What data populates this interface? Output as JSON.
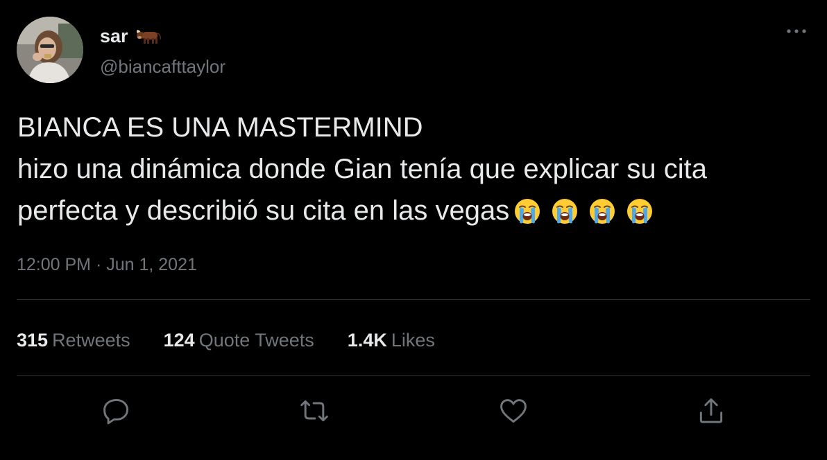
{
  "author": {
    "display_name": "sar",
    "name_emoji": "ox-emoji",
    "handle": "@biancafttaylor"
  },
  "tweet": {
    "lines": [
      "BIANCA ES UNA MASTERMIND",
      "hizo una dinámica donde Gian tenía que explicar su cita",
      "perfecta y describió su cita en las vegas"
    ],
    "trailing_emojis": [
      "loudly-crying-face",
      "loudly-crying-face",
      "loudly-crying-face",
      "loudly-crying-face"
    ],
    "timestamp": "12:00 PM · Jun 1, 2021"
  },
  "stats": {
    "retweets_count": "315",
    "retweets_label": "Retweets",
    "quotes_count": "124",
    "quotes_label": "Quote Tweets",
    "likes_count": "1.4K",
    "likes_label": "Likes"
  },
  "icons": {
    "more": "more-horizontal-icon",
    "reply": "reply-icon",
    "retweet": "retweet-icon",
    "like": "heart-icon",
    "share": "share-icon"
  },
  "colors": {
    "background": "#000000",
    "primary_text": "#e7e9ea",
    "secondary_text": "#71767b",
    "divider": "#2f3336"
  }
}
